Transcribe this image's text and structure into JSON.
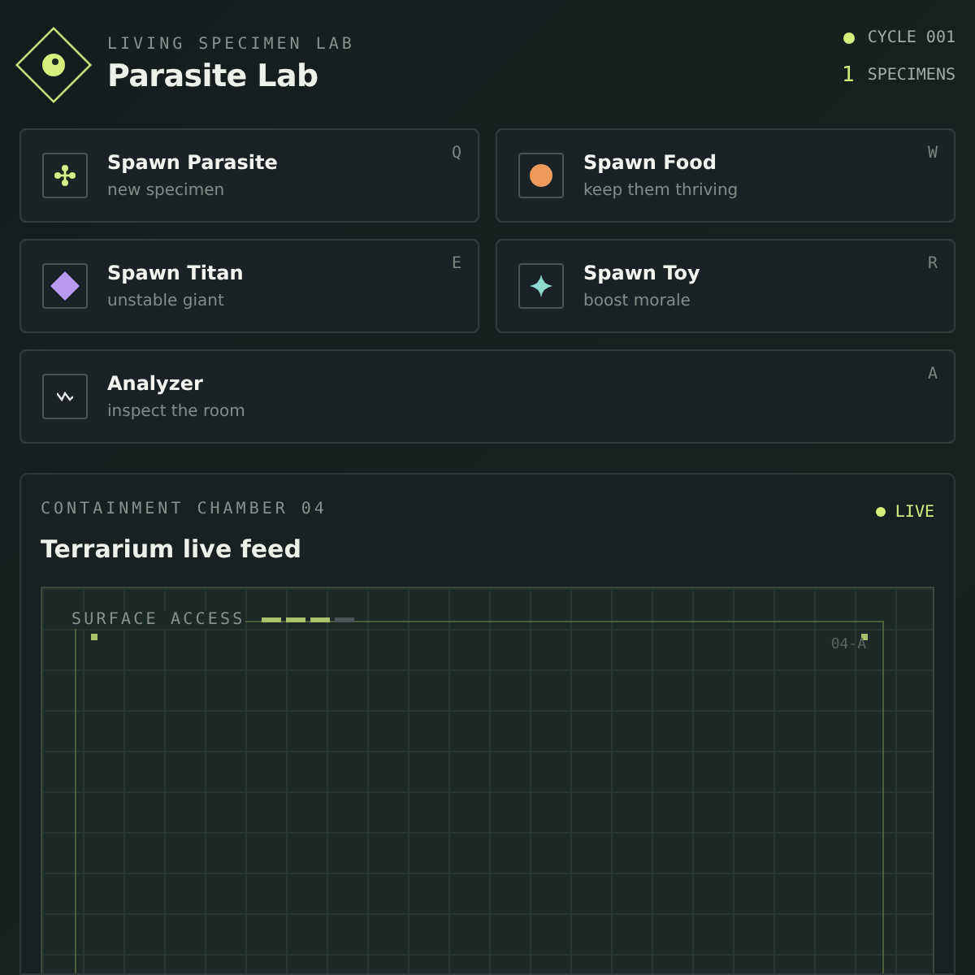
{
  "header": {
    "eyebrow": "LIVING SPECIMEN LAB",
    "title": "Parasite Lab",
    "cycle": "CYCLE 001",
    "specimen_count": "1",
    "specimen_label": "SPECIMENS"
  },
  "actions": [
    {
      "kind": "parasite",
      "title": "Spawn Parasite",
      "subtitle": "new specimen",
      "key": "Q"
    },
    {
      "kind": "food",
      "title": "Spawn Food",
      "subtitle": "keep them thriving",
      "key": "W"
    },
    {
      "kind": "titan",
      "title": "Spawn Titan",
      "subtitle": "unstable giant",
      "key": "E"
    },
    {
      "kind": "toy",
      "title": "Spawn Toy",
      "subtitle": "boost morale",
      "key": "R"
    },
    {
      "kind": "analyzer",
      "title": "Analyzer",
      "subtitle": "inspect the room",
      "key": "A"
    }
  ],
  "chamber": {
    "eyebrow": "CONTAINMENT CHAMBER 04",
    "title": "Terrarium live feed",
    "status": "LIVE",
    "surface": {
      "label": "SURFACE ACCESS",
      "level": 0.75
    },
    "tag": "04-A"
  }
}
